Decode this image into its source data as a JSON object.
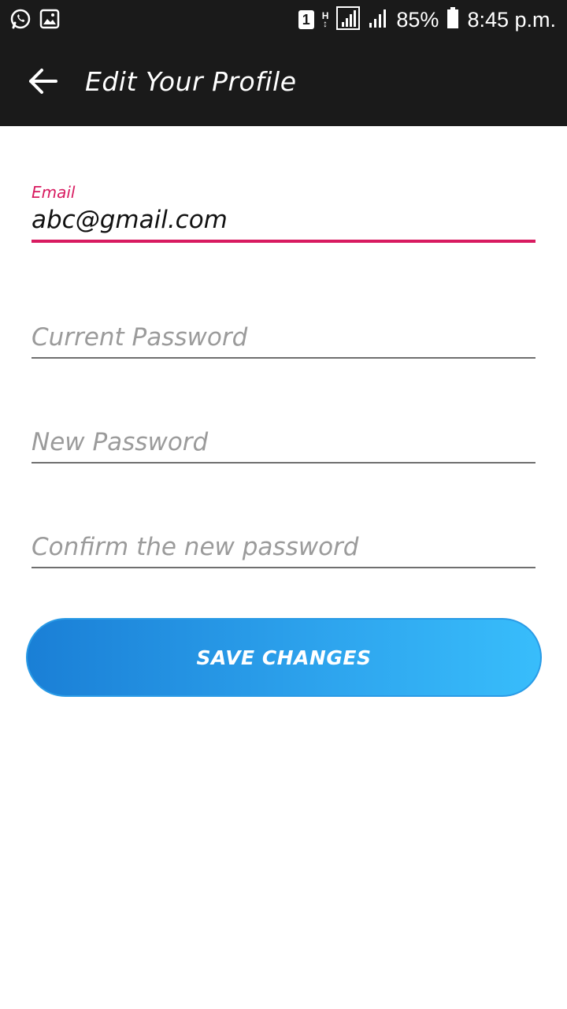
{
  "status_bar": {
    "sim_slot": "1",
    "network_type": "H",
    "battery": "85%",
    "time": "8:45 p.m.",
    "icons": [
      "whatsapp-icon",
      "gallery-icon",
      "sim-icon",
      "network-h-icon",
      "signal-icon",
      "signal-icon",
      "battery-icon"
    ]
  },
  "app_bar": {
    "title": "Edit Your Profile",
    "back_icon": "arrow-left-icon"
  },
  "form": {
    "email": {
      "label": "Email",
      "value": "abc@gmail.com",
      "placeholder": "Email"
    },
    "current_password": {
      "label": "",
      "value": "",
      "placeholder": "Current Password"
    },
    "new_password": {
      "label": "",
      "value": "",
      "placeholder": "New Password"
    },
    "confirm_password": {
      "label": "",
      "value": "",
      "placeholder": "Confirm the new password"
    }
  },
  "actions": {
    "save_label": "SAVE CHANGES"
  },
  "colors": {
    "app_bar": "#1a1a1a",
    "accent": "#d81b60",
    "button_start": "#1a7fd6",
    "button_end": "#38bdfb"
  }
}
